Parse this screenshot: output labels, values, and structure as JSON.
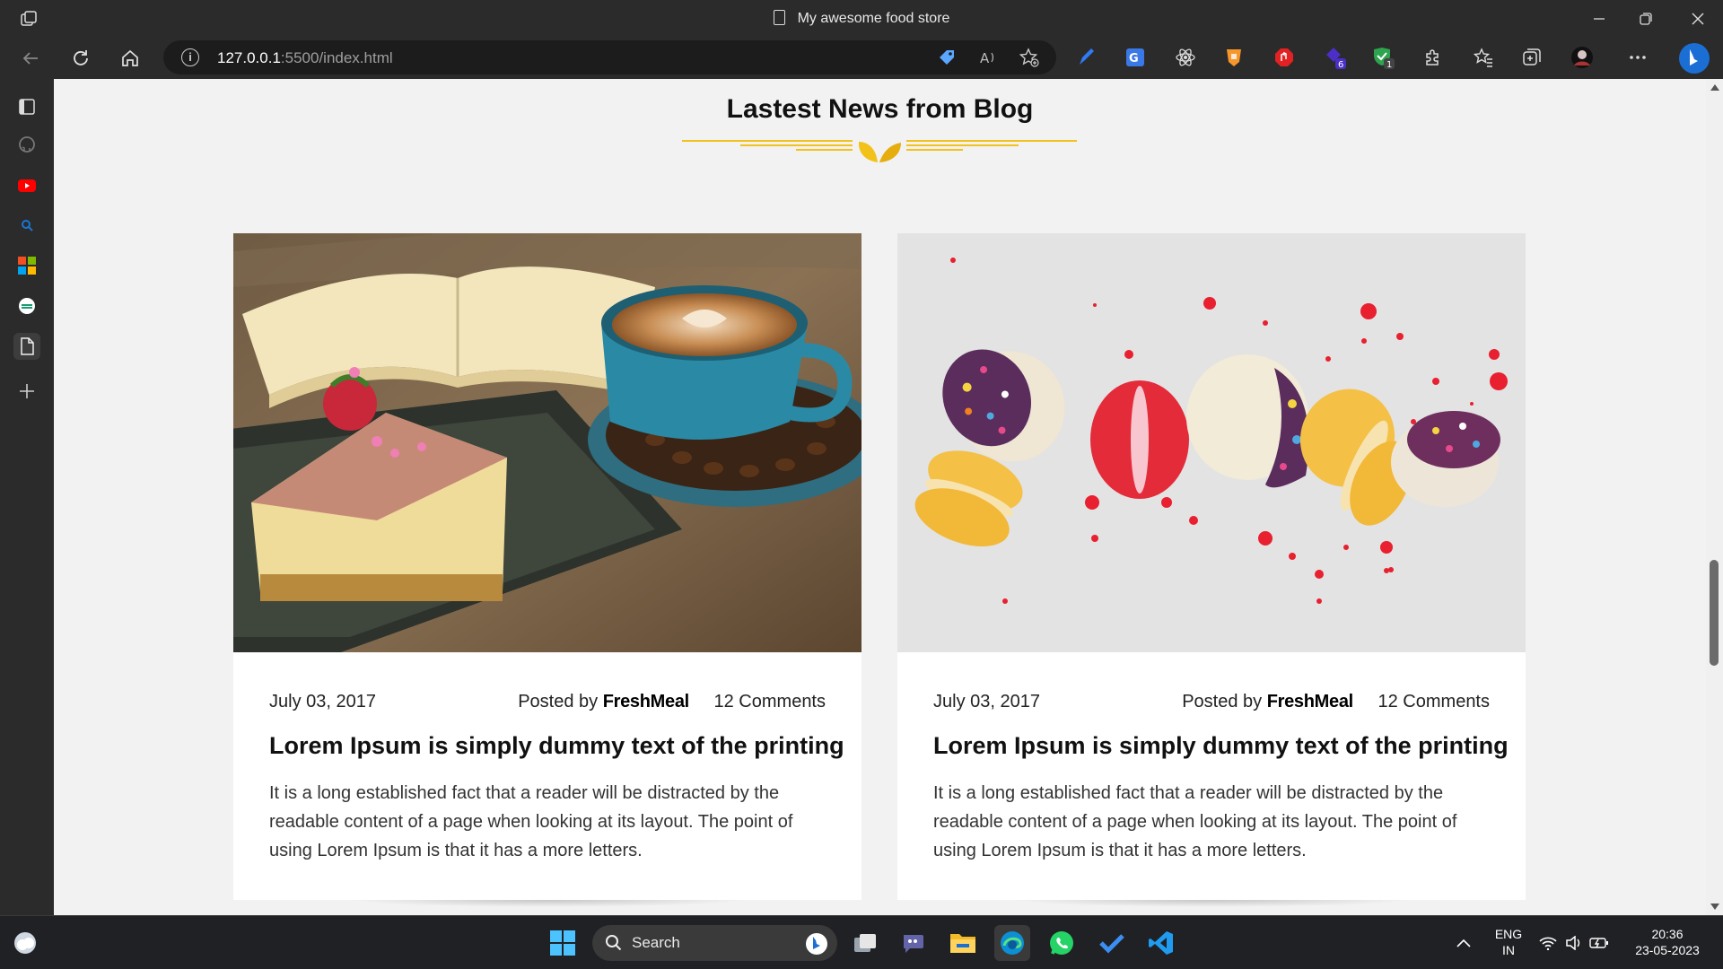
{
  "browser": {
    "window_title": "My awesome food store",
    "url_host": "127.0.0.1",
    "url_path": ":5500/index.html",
    "ext_badges": {
      "purple": "6",
      "shield": "1"
    }
  },
  "page": {
    "section_title": "Lastest News from Blog",
    "accent_color": "#f2c21a",
    "posts": [
      {
        "date": "July 03, 2017",
        "posted_by_prefix": "Posted by",
        "author": "FreshMeal",
        "comments": "12 Comments",
        "headline": "Lorem Ipsum is simply dummy text of the printing",
        "excerpt": "It is a long established fact that a reader will be distracted by the readable content of a page when looking at its layout. The point of using Lorem Ipsum is that it has a more letters.",
        "image": "cheesecake-coffee-book"
      },
      {
        "date": "July 03, 2017",
        "posted_by_prefix": "Posted by",
        "author": "FreshMeal",
        "comments": "12 Comments",
        "headline": "Lorem Ipsum is simply dummy text of the printing",
        "excerpt": "It is a long established fact that a reader will be distracted by the readable content of a page when looking at its layout. The point of using Lorem Ipsum is that it has a more letters.",
        "image": "macarons-with-sprinkles"
      }
    ]
  },
  "taskbar": {
    "search_label": "Search",
    "lang_line1": "ENG",
    "lang_line2": "IN",
    "time": "20:36",
    "date": "23-05-2023"
  }
}
